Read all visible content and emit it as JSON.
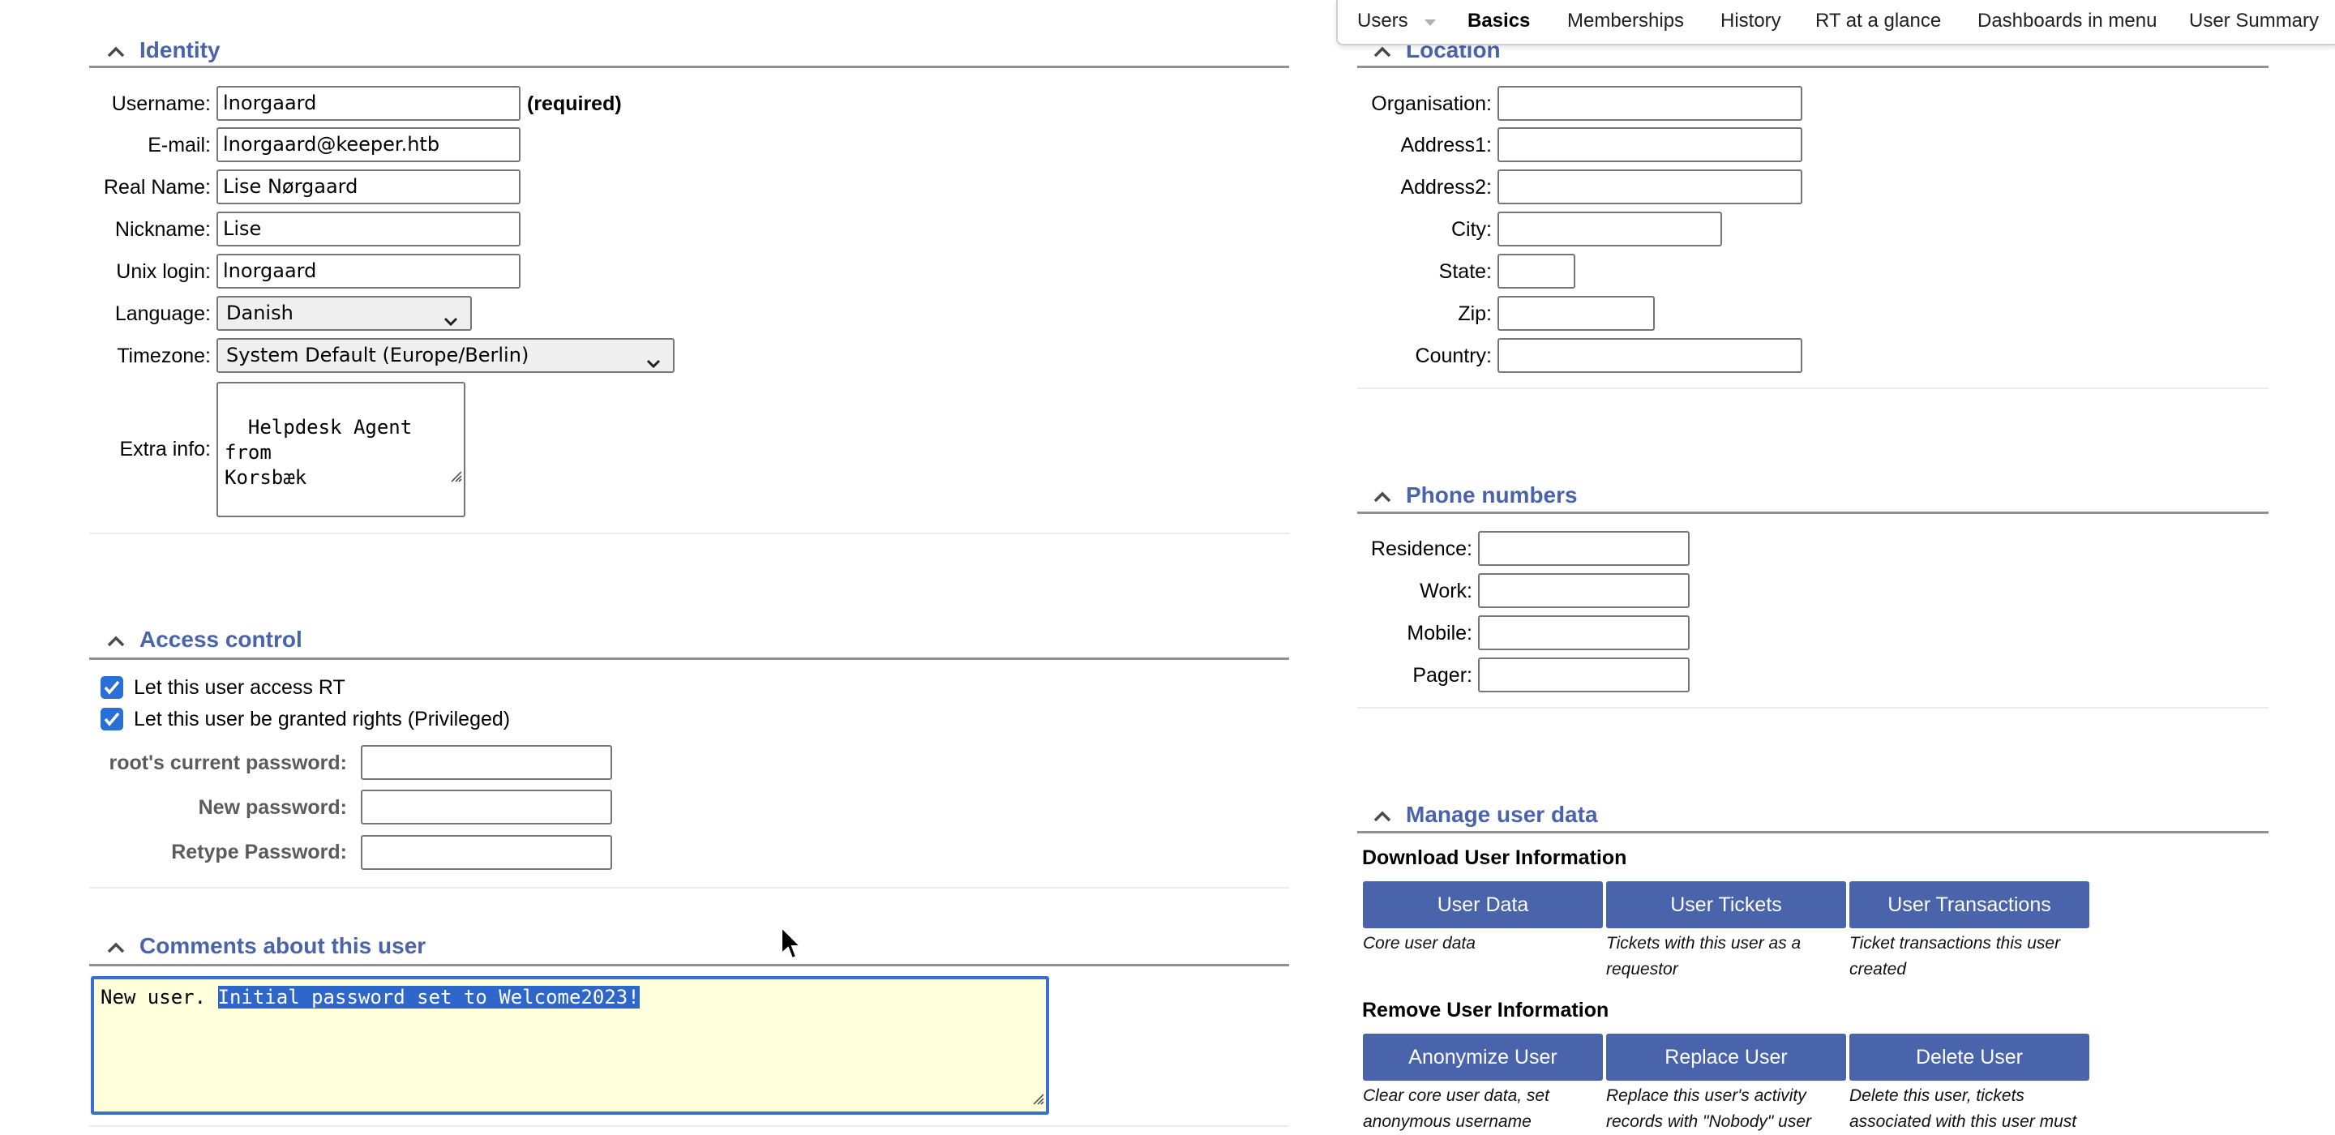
{
  "nav": {
    "items": [
      "Users",
      "Basics",
      "Memberships",
      "History",
      "RT at a glance",
      "Dashboards in menu",
      "User Summary"
    ],
    "active": "Basics"
  },
  "identity": {
    "title": "Identity",
    "username_label": "Username:",
    "username_value": "lnorgaard",
    "required_label": "(required)",
    "email_label": "E-mail:",
    "email_value": "lnorgaard@keeper.htb",
    "realname_label": "Real Name:",
    "realname_value": "Lise Nørgaard",
    "nickname_label": "Nickname:",
    "nickname_value": "Lise",
    "unixlogin_label": "Unix login:",
    "unixlogin_value": "lnorgaard",
    "language_label": "Language:",
    "language_value": "Danish",
    "timezone_label": "Timezone:",
    "timezone_value": "System Default (Europe/Berlin)",
    "extrainfo_label": "Extra info:",
    "extrainfo_value": "Helpdesk Agent from\nKorsbæk"
  },
  "access": {
    "title": "Access control",
    "check1_label": "Let this user access RT",
    "check1_checked": true,
    "check2_label": "Let this user be granted rights (Privileged)",
    "check2_checked": true,
    "current_pw_label": "root's current password:",
    "new_pw_label": "New password:",
    "retype_pw_label": "Retype Password:"
  },
  "comments": {
    "title": "Comments about this user",
    "text_prefix": "New user. ",
    "text_selected": "Initial password set to Welcome2023!"
  },
  "location": {
    "title": "Location",
    "organisation_label": "Organisation:",
    "address1_label": "Address1:",
    "address2_label": "Address2:",
    "city_label": "City:",
    "state_label": "State:",
    "zip_label": "Zip:",
    "country_label": "Country:"
  },
  "phones": {
    "title": "Phone numbers",
    "residence_label": "Residence:",
    "work_label": "Work:",
    "mobile_label": "Mobile:",
    "pager_label": "Pager:"
  },
  "manage": {
    "title": "Manage user data",
    "download_heading": "Download User Information",
    "user_data_btn": "User Data",
    "user_data_desc": "Core user data",
    "user_tickets_btn": "User Tickets",
    "user_tickets_desc": "Tickets with this user as a requestor",
    "user_transactions_btn": "User Transactions",
    "user_transactions_desc": "Ticket transactions this user created",
    "remove_heading": "Remove User Information",
    "anonymize_btn": "Anonymize User",
    "anonymize_desc": "Clear core user data, set anonymous username",
    "replace_btn": "Replace User",
    "replace_desc": "Replace this user's activity records with \"Nobody\" user",
    "delete_btn": "Delete User",
    "delete_desc": "Delete this user, tickets associated with this user must"
  },
  "colors": {
    "section_title": "#4a64ac",
    "button_bg": "#4a64ac",
    "checkbox": "#2a6fd6",
    "comment_bg": "#ffffdc",
    "selection": "#2f66c9"
  }
}
